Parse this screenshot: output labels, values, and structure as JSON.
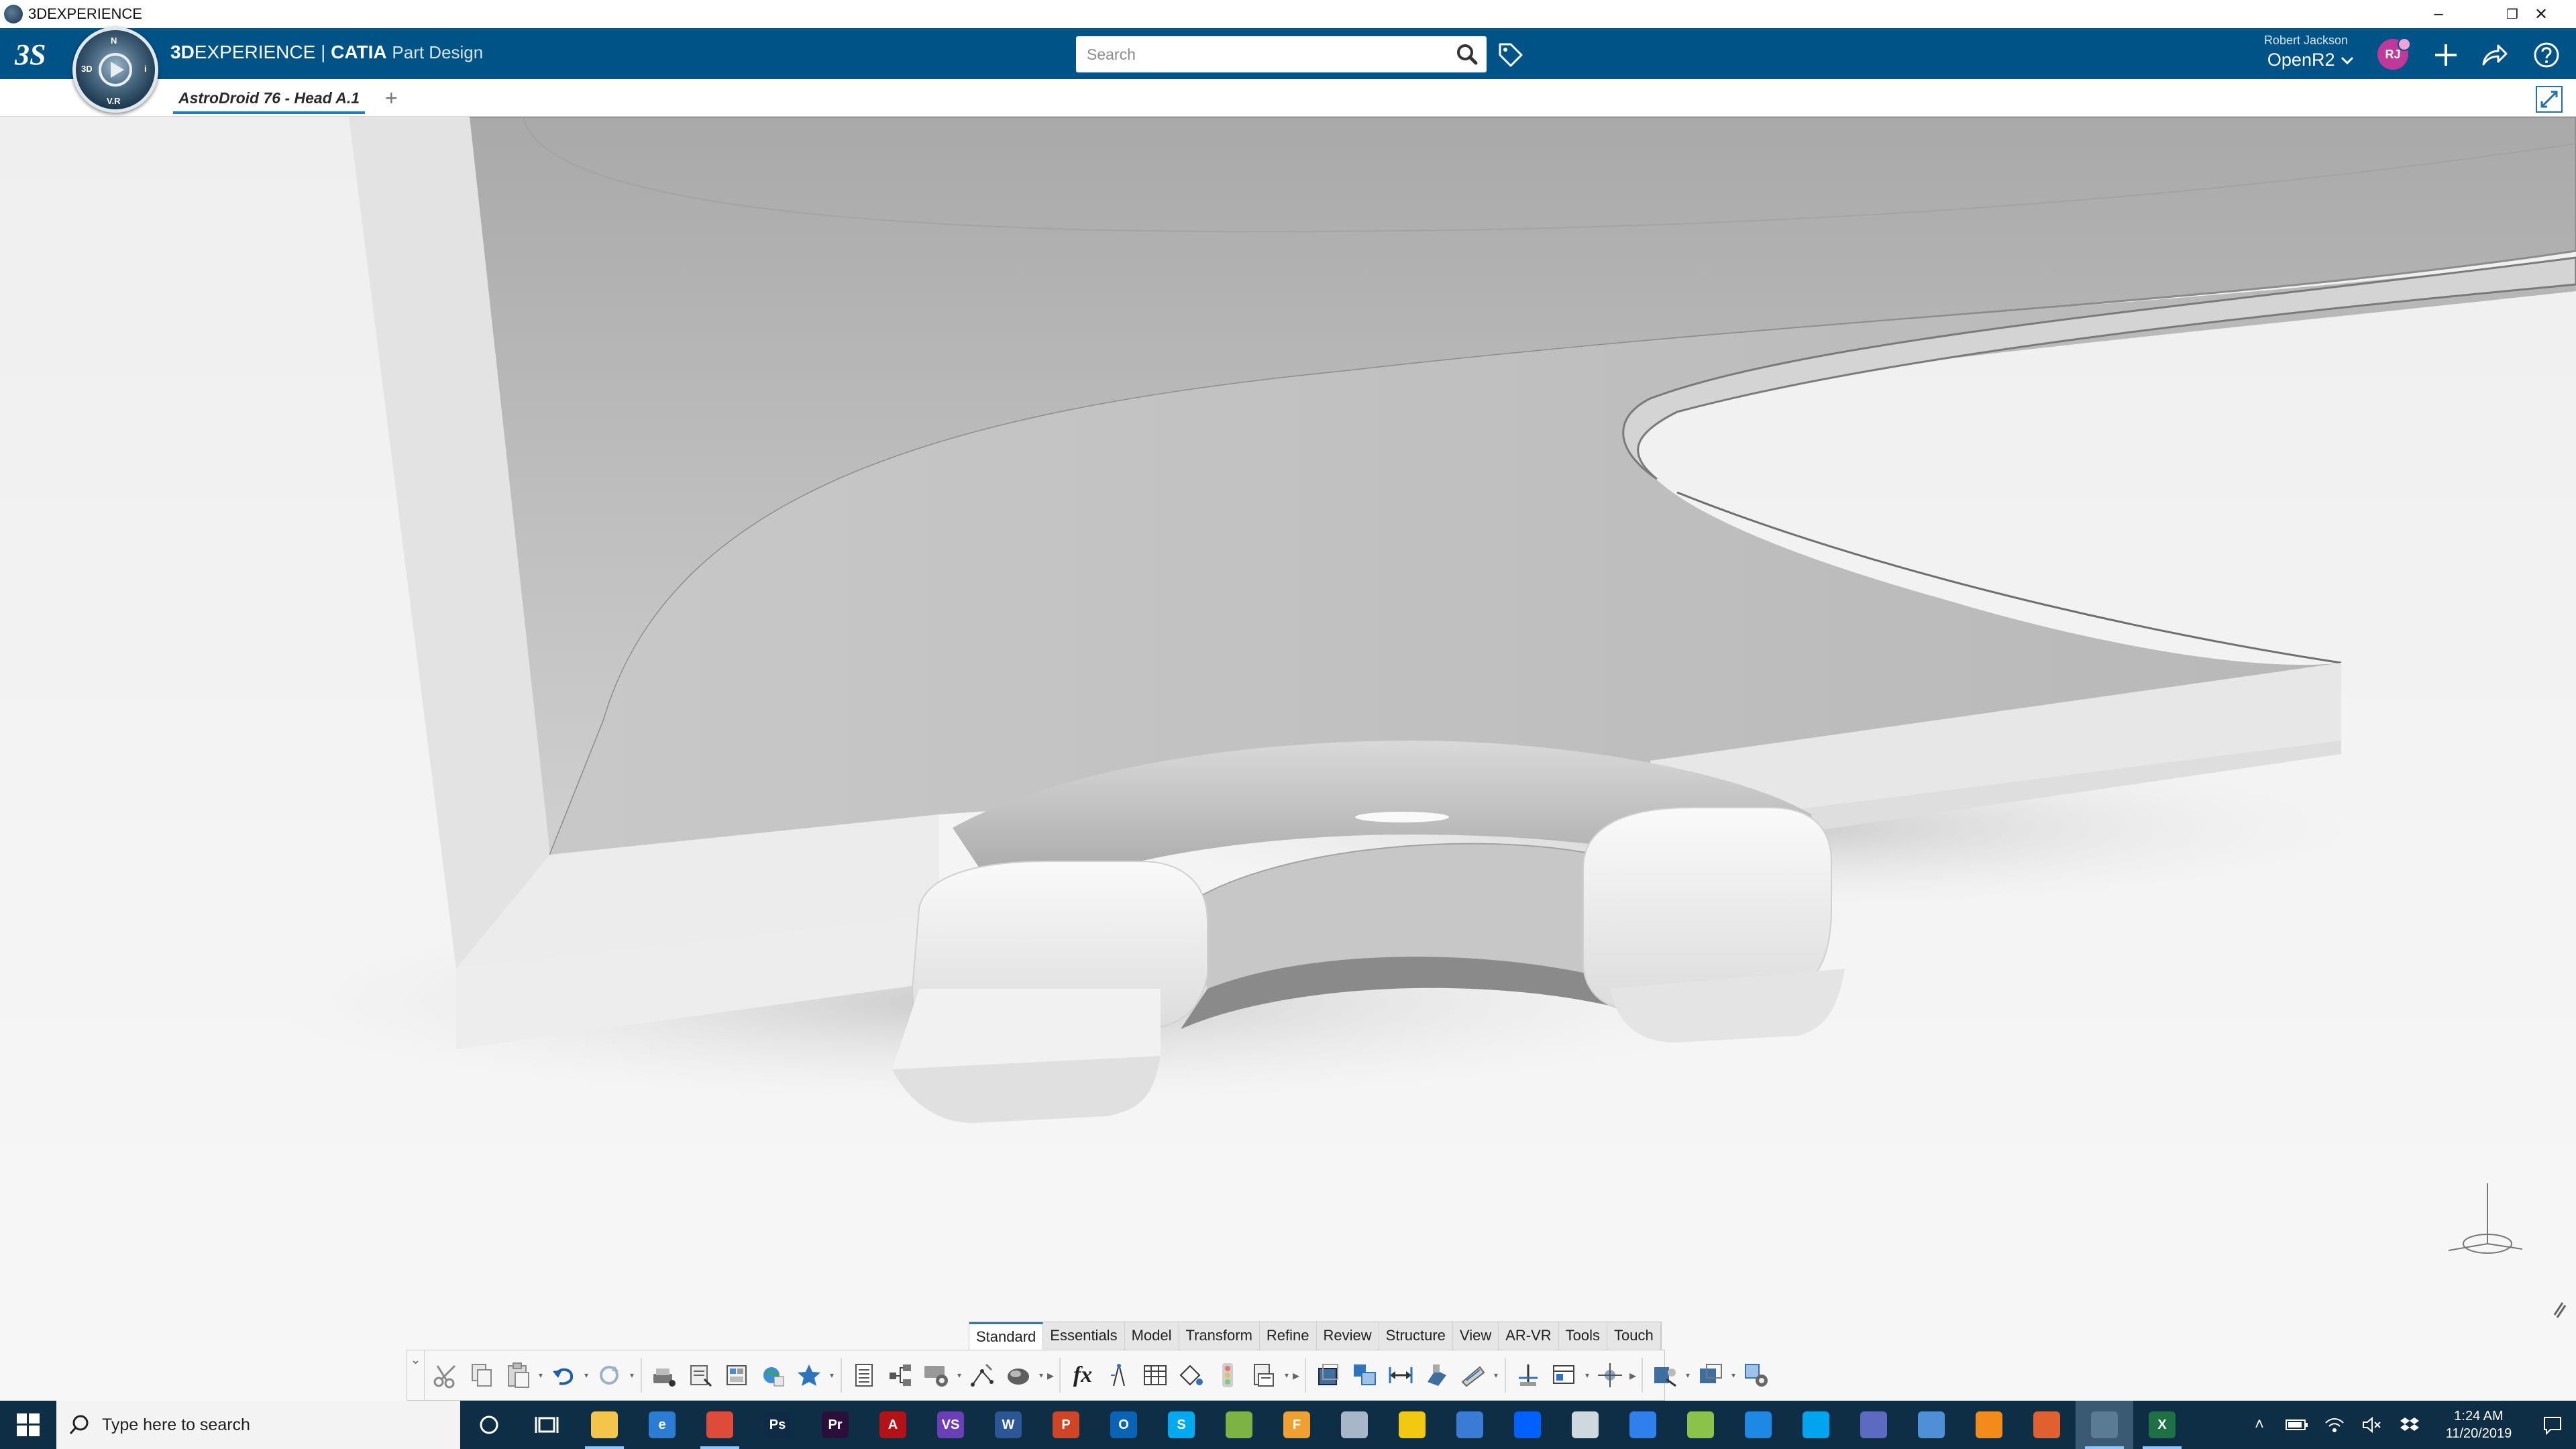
{
  "window": {
    "title": "3DEXPERIENCE",
    "minimize_glyph": "–",
    "restore_glyph": "❐",
    "close_glyph": "✕"
  },
  "header": {
    "brand_3d": "3D",
    "brand_experience": "EXPERIENCE",
    "brand_separator": " | ",
    "brand_catia": "CATIA",
    "brand_app": "Part Design",
    "compass_quadrants": [
      "3D",
      "i",
      "V.R",
      "N"
    ],
    "search": {
      "placeholder": "Search",
      "value": ""
    },
    "user_name": "Robert Jackson",
    "collab_space": "OpenR2",
    "avatar_initials": "RJ",
    "bg_color": "#005386"
  },
  "tabs": {
    "active_document": "AstroDroid 76 - Head A.1",
    "add_label": "+"
  },
  "action_bar": {
    "tabs": [
      "Standard",
      "Essentials",
      "Model",
      "Transform",
      "Refine",
      "Review",
      "Structure",
      "View",
      "AR-VR",
      "Tools",
      "Touch"
    ],
    "active_tab": "Standard",
    "collapse_glyph": "⌄",
    "formula_label": "fx"
  },
  "taskbar": {
    "search_text": "Type here to search",
    "time": "1:24 AM",
    "date": "11/20/2019",
    "apps": [
      {
        "name": "file-explorer",
        "glyph": "",
        "color": "#f3c54a",
        "running": true
      },
      {
        "name": "edge",
        "glyph": "e",
        "color": "#2b7cd3",
        "running": false
      },
      {
        "name": "chrome",
        "glyph": "",
        "color": "#de4b3a",
        "running": true
      },
      {
        "name": "photoshop",
        "glyph": "Ps",
        "color": "#0f2a44",
        "running": false
      },
      {
        "name": "premiere",
        "glyph": "Pr",
        "color": "#2a0f3a",
        "running": false
      },
      {
        "name": "acrobat",
        "glyph": "A",
        "color": "#b31217",
        "running": false
      },
      {
        "name": "visual-studio",
        "glyph": "VS",
        "color": "#6b3fb8",
        "running": false
      },
      {
        "name": "word",
        "glyph": "W",
        "color": "#2b5797",
        "running": false
      },
      {
        "name": "powerpoint",
        "glyph": "P",
        "color": "#d04526",
        "running": false
      },
      {
        "name": "outlook",
        "glyph": "O",
        "color": "#0a64b5",
        "running": false
      },
      {
        "name": "skype",
        "glyph": "S",
        "color": "#00a9f0",
        "running": false
      },
      {
        "name": "greenshot",
        "glyph": "",
        "color": "#7cb342",
        "running": false
      },
      {
        "name": "fusion",
        "glyph": "F",
        "color": "#f0a030",
        "running": false
      },
      {
        "name": "virtualbox",
        "glyph": "",
        "color": "#a7b6c8",
        "running": false
      },
      {
        "name": "power-bi",
        "glyph": "",
        "color": "#f2c811",
        "running": false
      },
      {
        "name": "github",
        "glyph": "",
        "color": "#3a7bd5",
        "running": false
      },
      {
        "name": "dropbox",
        "glyph": "",
        "color": "#0061ff",
        "running": false
      },
      {
        "name": "cloud-app",
        "glyph": "",
        "color": "#cfd8dc",
        "running": false
      },
      {
        "name": "vpn-app",
        "glyph": "",
        "color": "#2f80ed",
        "running": false
      },
      {
        "name": "3d-builder",
        "glyph": "",
        "color": "#8bc34a",
        "running": false
      },
      {
        "name": "store",
        "glyph": "",
        "color": "#1e88e5",
        "running": false
      },
      {
        "name": "messenger",
        "glyph": "",
        "color": "#00a4ef",
        "running": false
      },
      {
        "name": "app-23",
        "glyph": "",
        "color": "#5c6bc0",
        "running": false
      },
      {
        "name": "remote-desktop",
        "glyph": "",
        "color": "#4f8fd6",
        "running": false
      },
      {
        "name": "vlc",
        "glyph": "",
        "color": "#f28b1a",
        "running": false
      },
      {
        "name": "matlab",
        "glyph": "",
        "color": "#e06030",
        "running": false
      },
      {
        "name": "3dexperience",
        "glyph": "",
        "color": "#5b7b95",
        "running": true,
        "active": true
      },
      {
        "name": "excel",
        "glyph": "X",
        "color": "#1e7145",
        "running": true
      }
    ]
  }
}
